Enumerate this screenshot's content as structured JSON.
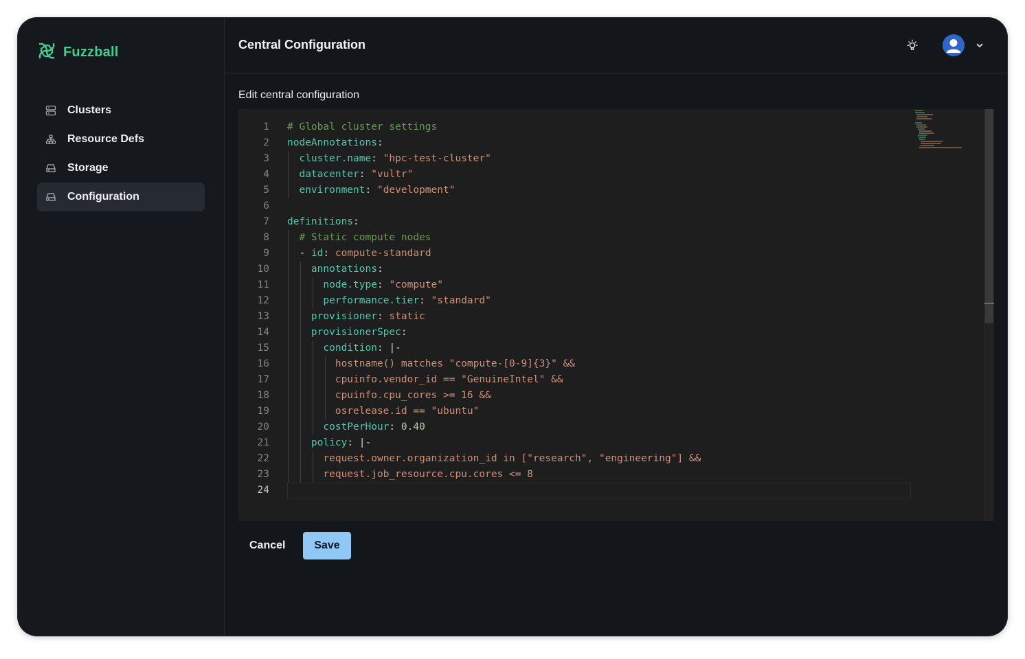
{
  "app": {
    "name": "Fuzzball"
  },
  "sidebar": {
    "items": [
      {
        "label": "Clusters",
        "icon": "server-stack-icon",
        "active": false
      },
      {
        "label": "Resource Defs",
        "icon": "hierarchy-icon",
        "active": false
      },
      {
        "label": "Storage",
        "icon": "drive-icon",
        "active": false
      },
      {
        "label": "Configuration",
        "icon": "drive-icon",
        "active": true
      }
    ]
  },
  "header": {
    "title": "Central Configuration",
    "theme_icon": "lightbulb-icon",
    "avatar_icon": "user-avatar-icon",
    "menu_icon": "chevron-down-icon"
  },
  "editor": {
    "label": "Edit central configuration",
    "current_line": 24,
    "lines": [
      {
        "n": "1",
        "text": "# Global cluster settings"
      },
      {
        "n": "2",
        "text": "nodeAnnotations:"
      },
      {
        "n": "3",
        "text": "  cluster.name: \"hpc-test-cluster\""
      },
      {
        "n": "4",
        "text": "  datacenter: \"vultr\""
      },
      {
        "n": "5",
        "text": "  environment: \"development\""
      },
      {
        "n": "6",
        "text": ""
      },
      {
        "n": "7",
        "text": "definitions:"
      },
      {
        "n": "8",
        "text": "  # Static compute nodes"
      },
      {
        "n": "9",
        "text": "  - id: compute-standard"
      },
      {
        "n": "10",
        "text": "    annotations:"
      },
      {
        "n": "11",
        "text": "      node.type: \"compute\""
      },
      {
        "n": "12",
        "text": "      performance.tier: \"standard\""
      },
      {
        "n": "13",
        "text": "    provisioner: static"
      },
      {
        "n": "14",
        "text": "    provisionerSpec:"
      },
      {
        "n": "15",
        "text": "      condition: |-"
      },
      {
        "n": "16",
        "text": "        hostname() matches \"compute-[0-9]{3}\" &&"
      },
      {
        "n": "17",
        "text": "        cpuinfo.vendor_id == \"GenuineIntel\" &&"
      },
      {
        "n": "18",
        "text": "        cpuinfo.cpu_cores >= 16 &&"
      },
      {
        "n": "19",
        "text": "        osrelease.id == \"ubuntu\""
      },
      {
        "n": "20",
        "text": "      costPerHour: 0.40"
      },
      {
        "n": "21",
        "text": "    policy: |-"
      },
      {
        "n": "22",
        "text": "      request.owner.organization_id in [\"research\", \"engineering\"] &&"
      },
      {
        "n": "23",
        "text": "      request.job_resource.cpu.cores <= 8"
      },
      {
        "n": "24",
        "text": ""
      }
    ]
  },
  "actions": {
    "cancel_label": "Cancel",
    "save_label": "Save"
  },
  "colors": {
    "accent": "#3ecf8e",
    "save": "#8fc8f5",
    "background": "#13161b"
  }
}
